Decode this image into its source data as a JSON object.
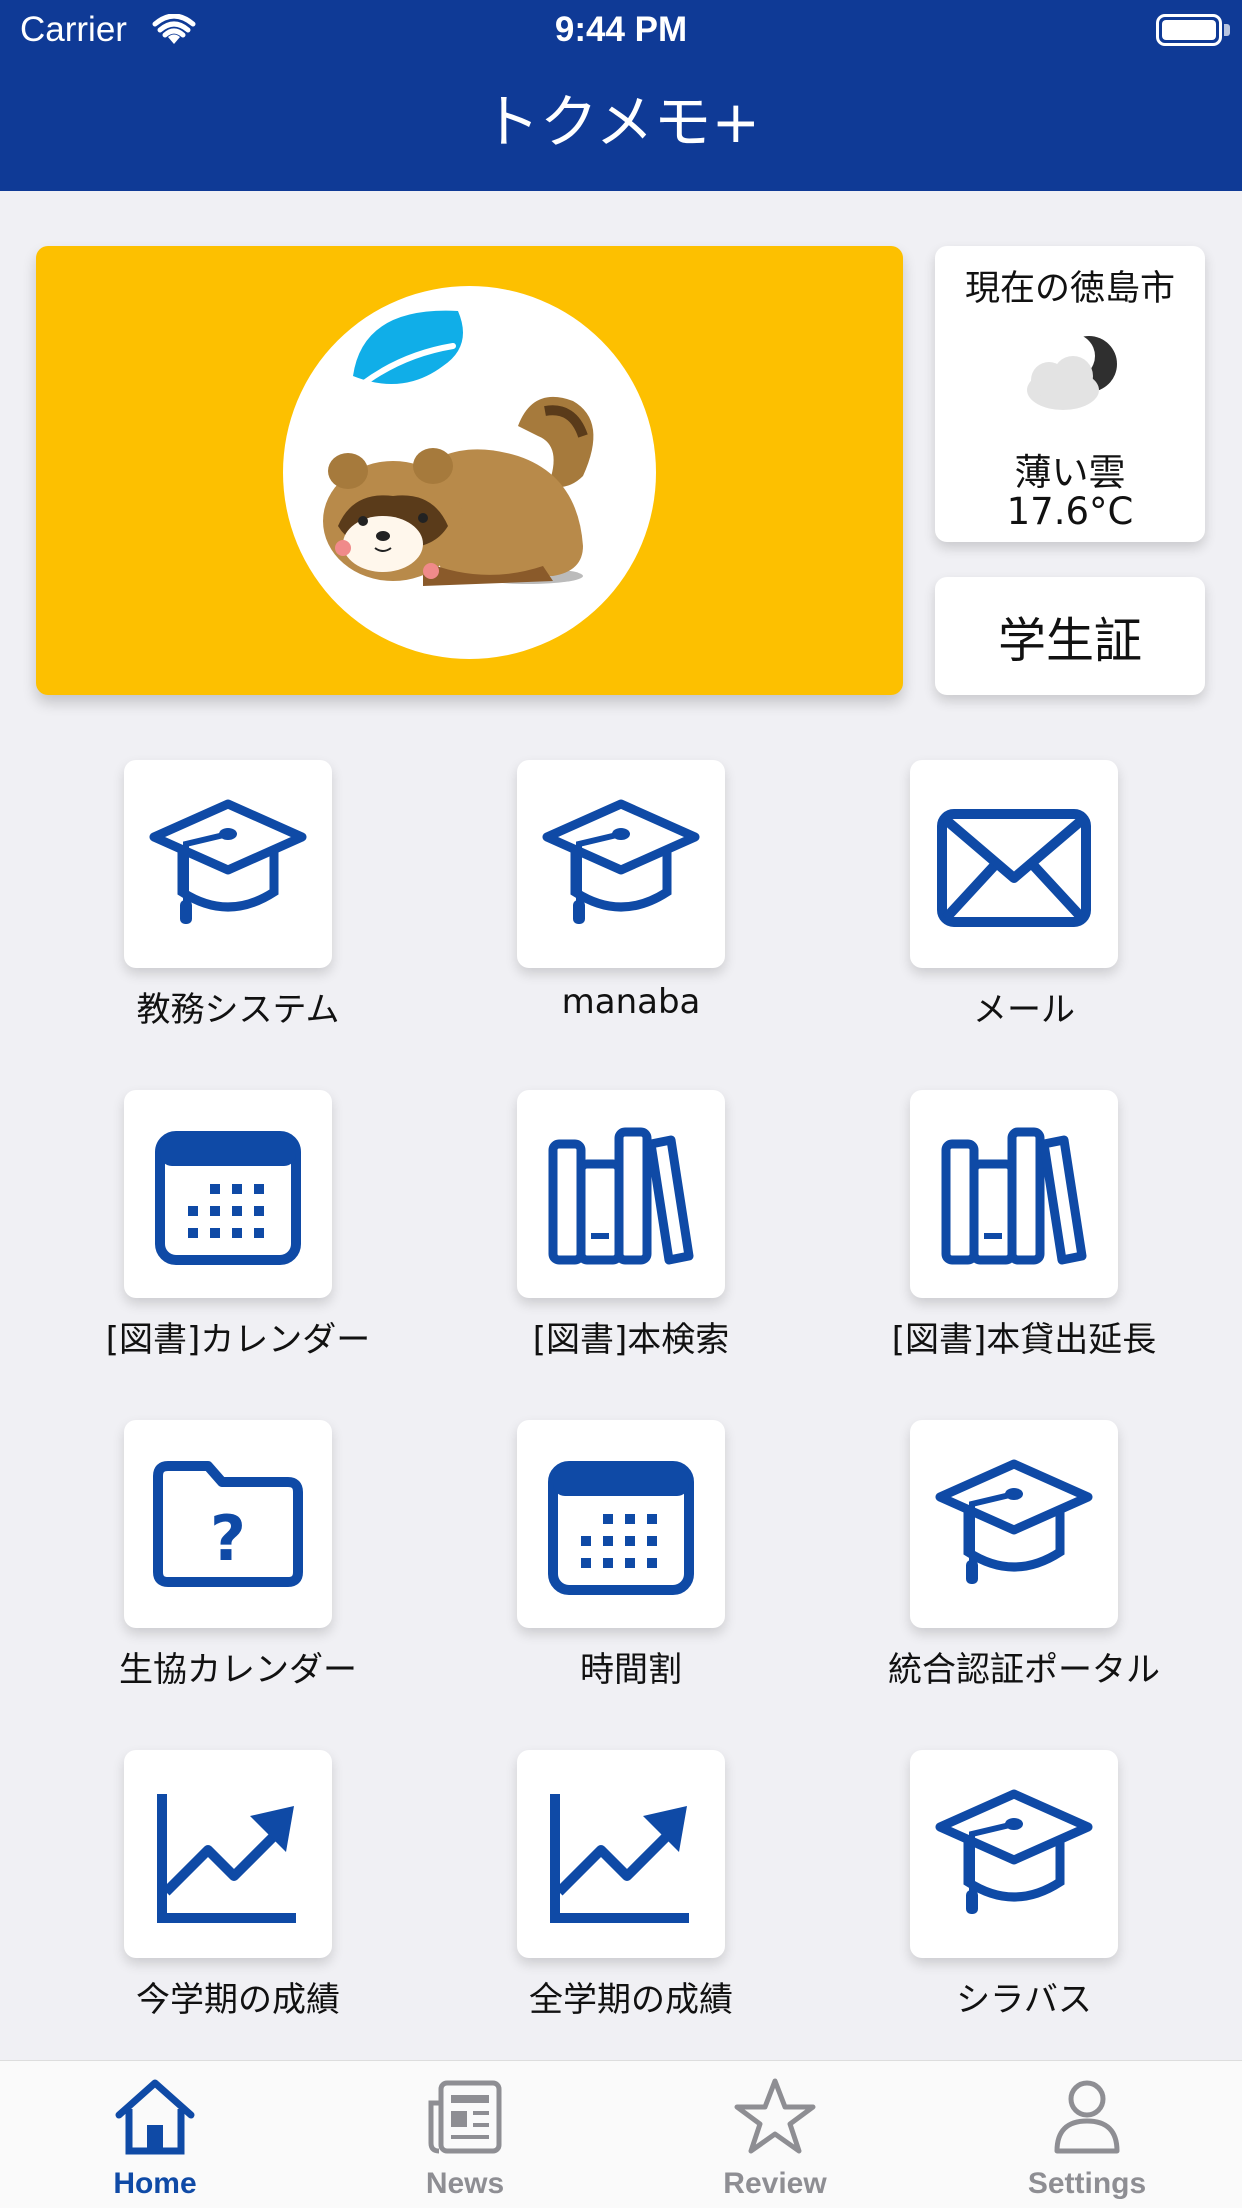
{
  "status_bar": {
    "carrier": "Carrier",
    "time": "9:44 PM"
  },
  "header": {
    "title": "トクメモ+"
  },
  "weather": {
    "city": "現在の徳島市",
    "description": "薄い雲",
    "temperature": "17.6°C",
    "icon": "partly-cloudy-night-icon"
  },
  "student_id": {
    "label": "学生証"
  },
  "grid": [
    {
      "label": "教務システム",
      "icon": "graduation-cap-icon"
    },
    {
      "label": "manaba",
      "icon": "graduation-cap-icon"
    },
    {
      "label": "メール",
      "icon": "envelope-icon"
    },
    {
      "label": "[図書]カレンダー",
      "icon": "calendar-icon"
    },
    {
      "label": "[図書]本検索",
      "icon": "books-icon"
    },
    {
      "label": "[図書]本貸出延長",
      "icon": "books-icon"
    },
    {
      "label": "生協カレンダー",
      "icon": "folder-question-icon"
    },
    {
      "label": "時間割",
      "icon": "calendar-icon"
    },
    {
      "label": "統合認証ポータル",
      "icon": "graduation-cap-icon"
    },
    {
      "label": "今学期の成績",
      "icon": "chart-up-icon"
    },
    {
      "label": "全学期の成績",
      "icon": "chart-up-icon"
    },
    {
      "label": "シラバス",
      "icon": "graduation-cap-icon"
    }
  ],
  "tabs": [
    {
      "label": "Home",
      "icon": "home-icon",
      "active": true
    },
    {
      "label": "News",
      "icon": "newspaper-icon",
      "active": false
    },
    {
      "label": "Review",
      "icon": "star-icon",
      "active": false
    },
    {
      "label": "Settings",
      "icon": "person-icon",
      "active": false
    }
  ],
  "colors": {
    "header": "#0f3a96",
    "accent": "#0f4aa6",
    "banner": "#fdc000",
    "background": "#f0f0f4"
  }
}
